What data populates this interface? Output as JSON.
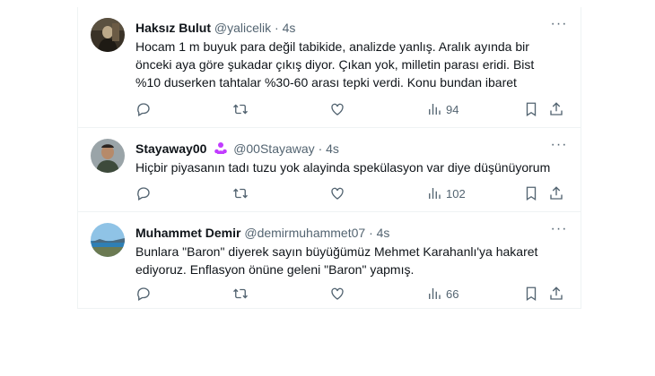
{
  "tweets": [
    {
      "name": "Haksız Bulut",
      "handle": "@yalicelik",
      "dot": "·",
      "time": "4s",
      "text": "Hocam 1 m buyuk para değil tabikide, analizde yanlış. Aralık ayında bir önceki aya göre şukadar çıkış diyor. Çıkan yok, milletin parası eridi. Bist %10 duserken tahtalar %30-60 arası tepki verdi. Konu bundan ibaret",
      "views": "94"
    },
    {
      "name": "Stayaway00",
      "handle": "@00Stayaway",
      "dot": "·",
      "time": "4s",
      "text": "Hiçbir piyasanın tadı tuzu yok alayinda spekülasyon var diye düşünüyorum",
      "views": "102"
    },
    {
      "name": "Muhammet Demir",
      "handle": "@demirmuhammet07",
      "dot": "·",
      "time": "4s",
      "text": "Bunlara \"Baron\" diyerek sayın büyüğümüz Mehmet Karahanlı'ya hakaret ediyoruz. Enflasyon önüne geleni \"Baron\" yapmış.",
      "views": "66"
    }
  ],
  "icons": {
    "more": "more-dots-icon",
    "reply": "reply-icon",
    "retweet": "retweet-icon",
    "like": "heart-icon",
    "views": "views-chart-icon",
    "bookmark": "bookmark-icon",
    "share": "share-icon",
    "badge": "people-badge-icon"
  },
  "colors": {
    "muted": "#536471",
    "text": "#0f1419",
    "badge": "#c13cff",
    "border": "#eff3f4"
  }
}
